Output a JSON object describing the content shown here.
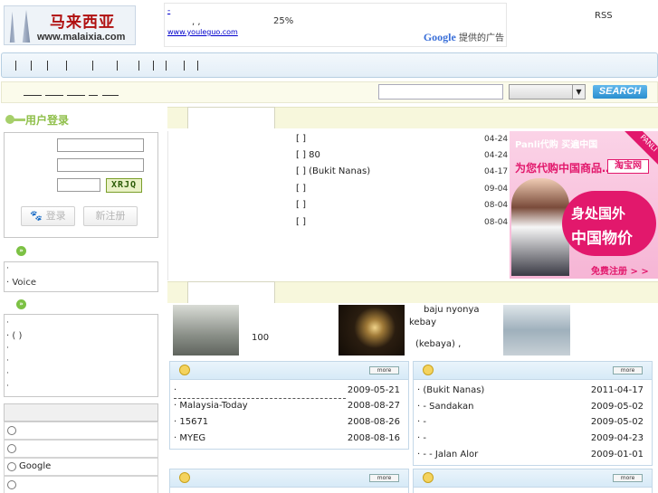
{
  "header": {
    "logo_cn": "马来西亚",
    "logo_url": "www.malaixia.com",
    "ad_line1": "-",
    "ad_line2": ",     ,",
    "ad_pct": "25%",
    "ad_link": "www.youleguo.com",
    "google_label": "Google",
    "google_suffix": "提供的广告",
    "rss": "RSS"
  },
  "search": {
    "input_value": "",
    "select_value": "",
    "button_label": "SEARCH"
  },
  "login": {
    "title": "用户登录",
    "captcha": "XRJQ",
    "login_button": "登录",
    "register_button": "新注册"
  },
  "sidebar": {
    "box1_items": [
      "·",
      "·        Voice"
    ],
    "box2_items": [
      "·",
      "·    (    )",
      "·",
      "·",
      "·",
      "·"
    ],
    "poll_options": [
      "",
      "",
      "Google",
      ""
    ]
  },
  "news": {
    "items": [
      {
        "title": "[ ]",
        "date": "04-24"
      },
      {
        "title": "[    ] 80",
        "date": "04-24"
      },
      {
        "title": "[   ]     (Bukit Nanas)",
        "date": "04-17"
      },
      {
        "title": "[    ]",
        "date": "09-04"
      },
      {
        "title": "[    ]",
        "date": "08-04"
      },
      {
        "title": "[    ]",
        "date": "08-04"
      }
    ]
  },
  "ad2": {
    "line1": "Panli代购 买遍中国",
    "ribbon": "PANLI",
    "line2": "为您代购中国商品…",
    "taobao": "淘宝网",
    "bubble1": "身处国外",
    "bubble2": "中国物价",
    "register": "免费注册 > >"
  },
  "photos": {
    "caption1": "100",
    "caption2a": "baju nyonya",
    "caption2b": "kebay",
    "caption2c": "(kebaya)     ,"
  },
  "panels": {
    "more_label": "more",
    "left_rows": [
      {
        "text": "·",
        "date": "2009-05-21"
      },
      {
        "text": "·        Malaysia-Today",
        "date": "2008-08-27"
      },
      {
        "text": "·   15671",
        "date": "2008-08-26"
      },
      {
        "text": "·          MYEG",
        "date": "2008-08-16"
      }
    ],
    "right_rows": [
      {
        "text": "·   (Bukit Nanas)",
        "date": "2011-04-17"
      },
      {
        "text": "·       - Sandakan",
        "date": "2009-05-02"
      },
      {
        "text": "·       -",
        "date": "2009-05-02"
      },
      {
        "text": "·         -",
        "date": "2009-04-23"
      },
      {
        "text": "·         -     - Jalan Alor",
        "date": "2009-01-01"
      }
    ]
  }
}
